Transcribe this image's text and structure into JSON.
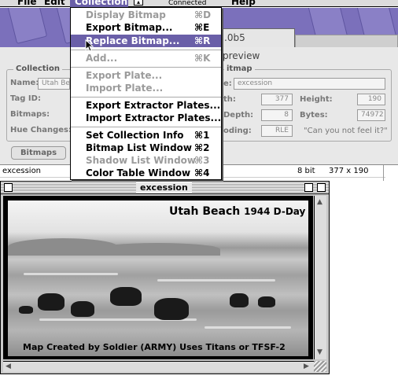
{
  "menubar": {
    "items": [
      "File",
      "Edit",
      "Collection",
      "Help"
    ],
    "status": "Connected"
  },
  "tab_title": ".0b5",
  "preview_label": "preview",
  "collection_group": {
    "title": "Collection",
    "name_label": "Name:",
    "name_value": "Utah Bea",
    "tag_label": "Tag ID:",
    "bitmaps_label": "Bitmaps:",
    "hue_label": "Hue Changes:"
  },
  "bitmap_group": {
    "title": "itmap",
    "name_label": "e:",
    "name_value": "excession",
    "width_label": "th:",
    "width_value": "377",
    "height_label": "Height:",
    "height_value": "190",
    "depth_label": "Depth:",
    "depth_value": "8",
    "bytes_label": "Bytes:",
    "bytes_value": "74972",
    "coding_label": "oding:",
    "coding_value": "RLE",
    "quote": "\"Can you not feel it?\""
  },
  "bitmaps_tab": "Bitmaps",
  "list_row": {
    "name": "excession",
    "depth": "8 bit",
    "size": "377 x 190"
  },
  "window": {
    "title": "excession",
    "image_title": "Utah Beach",
    "image_year": "1944 D-Day",
    "image_caption": "Map Created by Soldier (ARMY)  Uses Titans or TFSF-2"
  },
  "collection_menu": {
    "items": [
      {
        "label": "Display Bitmap",
        "key": "⌘D",
        "state": "disabled"
      },
      {
        "label": "Export Bitmap...",
        "key": "⌘E",
        "state": "enabled"
      },
      {
        "label": "Replace Bitmap...",
        "key": "⌘R",
        "state": "highlighted"
      },
      {
        "label": "Add...",
        "key": "⌘K",
        "state": "disabled"
      },
      {
        "label": "Export Plate...",
        "key": "",
        "state": "disabled"
      },
      {
        "label": "Import Plate...",
        "key": "",
        "state": "disabled"
      },
      {
        "label": "Export Extractor Plates...",
        "key": "",
        "state": "enabled"
      },
      {
        "label": "Import Extractor Plates...",
        "key": "",
        "state": "enabled"
      },
      {
        "label": "Set Collection Info",
        "key": "⌘1",
        "state": "enabled"
      },
      {
        "label": "Bitmap List Window",
        "key": "⌘2",
        "state": "enabled"
      },
      {
        "label": "Shadow List Window",
        "key": "⌘3",
        "state": "disabled"
      },
      {
        "label": "Color Table Window",
        "key": "⌘4",
        "state": "enabled"
      }
    ]
  },
  "colors": {
    "accent": "#6a5fa8",
    "band": "#7b70bb"
  }
}
